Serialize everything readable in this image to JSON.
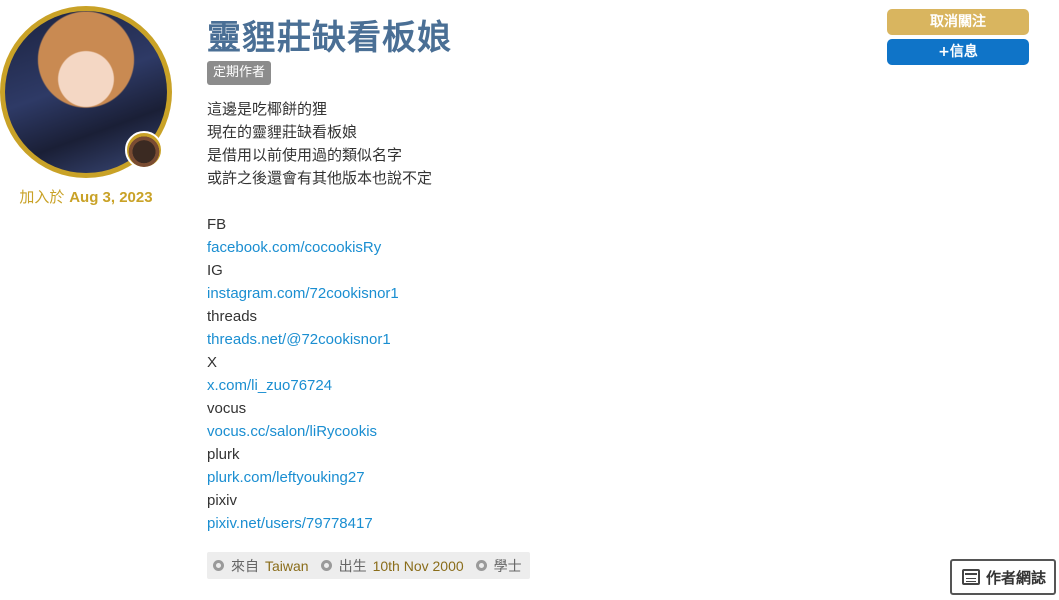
{
  "profile": {
    "name": "靈貍莊缺看板娘",
    "badge": "定期作者",
    "joined_label": "加入於",
    "joined_date": "Aug 3, 2023"
  },
  "bio": {
    "lines": [
      "這邊是吃椰餅的狸",
      "現在的靈貍莊缺看板娘",
      "是借用以前使用過的類似名字",
      "或許之後還會有其他版本也說不定"
    ],
    "links": [
      {
        "label": "FB",
        "url_text": "facebook.com/cocookisRy"
      },
      {
        "label": "IG",
        "url_text": "instagram.com/72cookisnor1"
      },
      {
        "label": "threads",
        "url_text": "threads.net/@72cookisnor1"
      },
      {
        "label": "X",
        "url_text": "x.com/li_zuo76724"
      },
      {
        "label": "vocus",
        "url_text": "vocus.cc/salon/liRycookis"
      },
      {
        "label": "plurk",
        "url_text": "plurk.com/leftyouking27"
      },
      {
        "label": "pixiv",
        "url_text": "pixiv.net/users/79778417"
      }
    ]
  },
  "info": {
    "from_label": "來自",
    "from_value": "Taiwan",
    "born_label": "出生",
    "born_value": "10th Nov 2000",
    "edu_label": "學士"
  },
  "actions": {
    "unfollow_label": "取消關注",
    "message_label": "+信息",
    "blog_label": "作者網誌"
  },
  "colors": {
    "gold": "#c9a227",
    "name_blue": "#4a6f95",
    "link_blue": "#1a8ed1",
    "message_blue": "#0f74c8",
    "unfollow_gold": "#d9b55f"
  }
}
